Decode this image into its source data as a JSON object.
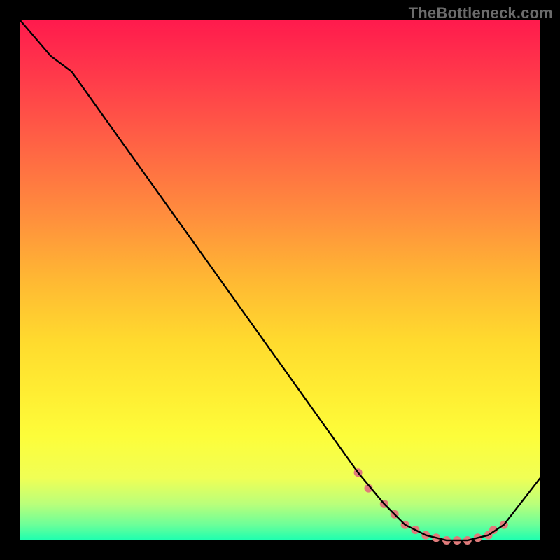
{
  "watermark": "TheBottleneck.com",
  "chart_data": {
    "type": "line",
    "title": "",
    "xlabel": "",
    "ylabel": "",
    "xlim": [
      0,
      100
    ],
    "ylim": [
      0,
      100
    ],
    "grid": false,
    "series": [
      {
        "name": "bottleneck-curve",
        "color": "#000000",
        "x": [
          0,
          6,
          10,
          20,
          30,
          40,
          50,
          60,
          65,
          70,
          74,
          78,
          82,
          86,
          90,
          93,
          100
        ],
        "y": [
          100,
          93,
          90,
          76,
          62,
          48,
          34,
          20,
          13,
          7,
          3,
          1,
          0,
          0,
          1,
          3,
          12
        ]
      }
    ],
    "markers": {
      "name": "highlight-dots",
      "color": "#e07b7b",
      "radius": 6,
      "x": [
        65,
        67,
        70,
        72,
        74,
        76,
        78,
        80,
        82,
        84,
        86,
        88,
        90,
        91,
        93
      ],
      "y": [
        13,
        10,
        7,
        5,
        3,
        2,
        1,
        0.5,
        0,
        0,
        0,
        0.5,
        1,
        2,
        3
      ]
    }
  },
  "colors": {
    "frame": "#000000",
    "line": "#000000",
    "marker": "#e07b7b"
  }
}
